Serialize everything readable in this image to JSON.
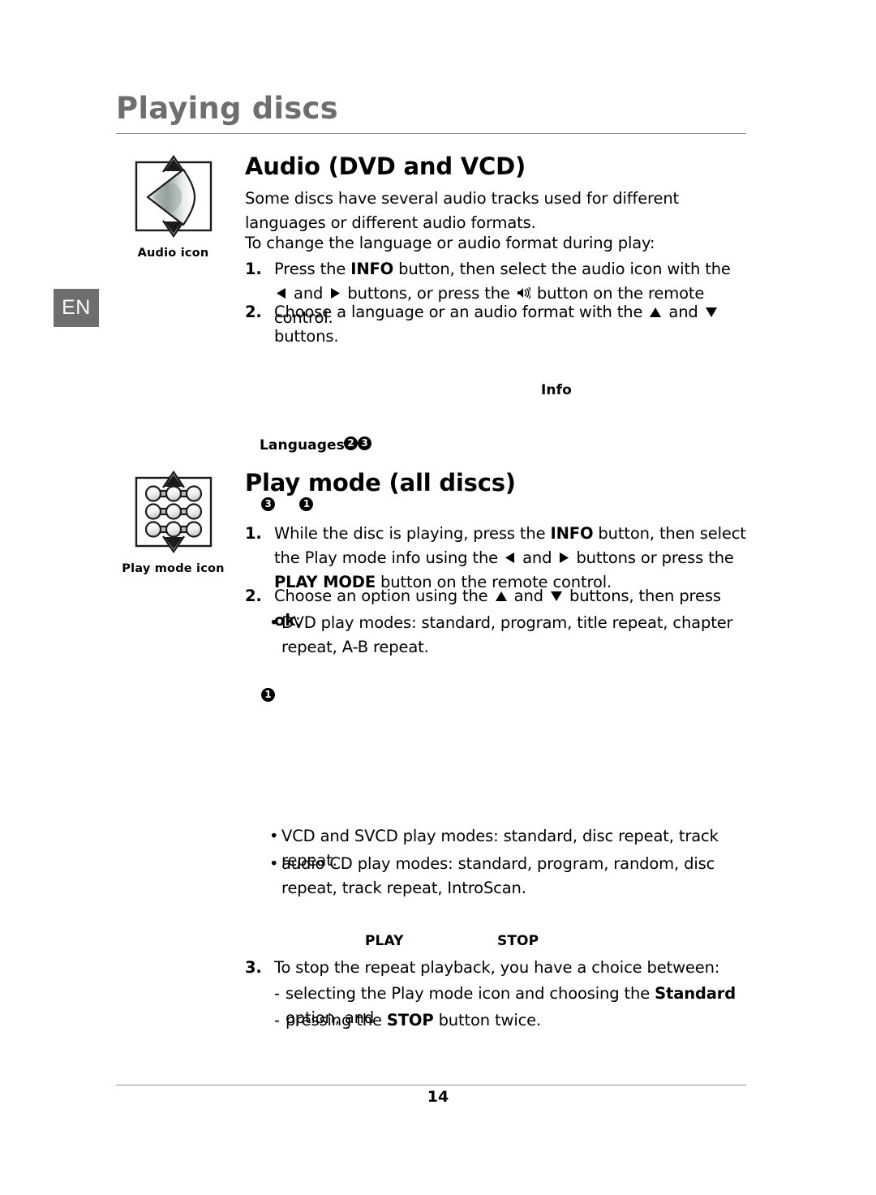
{
  "document": {
    "chapter_title": "Playing discs",
    "language_tab": "EN",
    "page_number": "14"
  },
  "icons": {
    "audio": {
      "name": "audio-icon",
      "caption": "Audio icon"
    },
    "play_mode": {
      "name": "play-mode-icon",
      "caption": "Play mode icon"
    }
  },
  "sections": {
    "audio": {
      "heading": "Audio (DVD and VCD)",
      "intro": "Some discs have several audio tracks used for different languages or different audio formats.",
      "lead_in": "To change the language or audio format during play:",
      "step1": {
        "number": "1.",
        "part_a": "Press the ",
        "bold_a": "INFO",
        "part_b": " button, then select the audio icon with the ",
        "part_c": " and ",
        "part_d": " buttons, or press the ",
        "part_e": " button on the remote control."
      },
      "step2": {
        "number": "2.",
        "part_a": "Choose a language or an audio format with the ",
        "part_b": " and ",
        "part_c": " buttons."
      },
      "screen_labels": {
        "info": "Info",
        "languages": "Languages",
        "languages_markers": [
          "2",
          "3"
        ]
      }
    },
    "play_mode": {
      "heading": "Play mode (all discs)",
      "heading_markers": [
        "3",
        "1"
      ],
      "standalone_marker": "1",
      "step1": {
        "number": "1.",
        "part_a": "While the disc is playing, press the ",
        "bold_a": "INFO",
        "part_b": " button, then select the Play mode info using the ",
        "part_c": " and ",
        "part_d": " buttons or press the ",
        "bold_b": "PLAY MODE",
        "part_e": " button on the remote control."
      },
      "step2": {
        "number": "2.",
        "part_a": "Choose an option using the ",
        "part_b": " and ",
        "part_c": " buttons, then press ",
        "bold_a": "ok",
        "part_d": ":"
      },
      "bullets": [
        "DVD play modes: standard, program, title repeat, chapter repeat, A-B repeat.",
        "VCD and SVCD play modes: standard, disc repeat, track repeat.",
        "audio CD play modes: standard, program, random, disc repeat, track repeat, IntroScan."
      ],
      "screen_labels": {
        "play": "PLAY",
        "stop": "STOP"
      },
      "step3": {
        "number": "3.",
        "text": "To stop the repeat playback, you have a choice between:",
        "option1_a": "selecting the Play mode icon and choosing the ",
        "option1_bold": "Standard",
        "option1_b": " option, and",
        "option2_a": "pressing the ",
        "option2_bold": "STOP",
        "option2_b": " button twice."
      }
    }
  },
  "colors": {
    "chapter_title": "#6e6e6e",
    "lang_tab_bg": "#6e6e6e",
    "rule": "#8d8d8d",
    "text": "#000000"
  }
}
